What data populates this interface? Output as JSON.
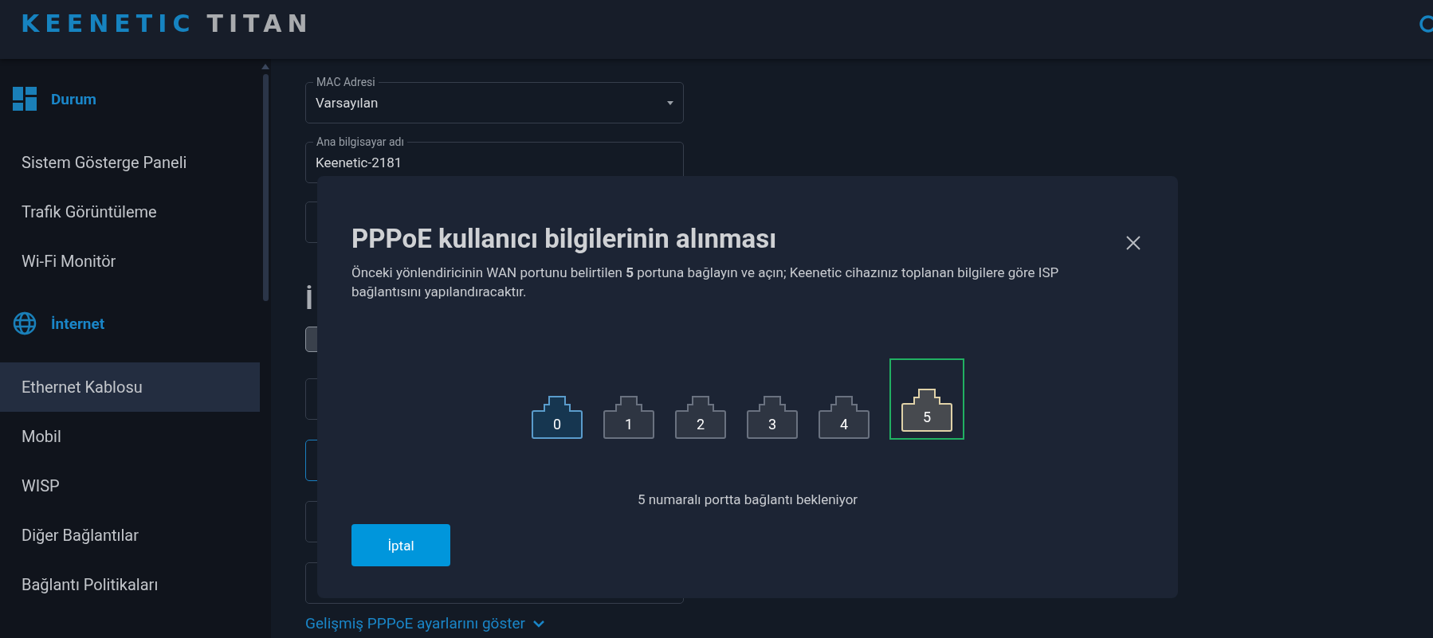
{
  "header": {
    "logo": {
      "brand": "KEENETIC",
      "model": "TITAN"
    }
  },
  "sidebar": {
    "sections": [
      {
        "title": "Durum",
        "items": [
          {
            "label": "Sistem Gösterge Paneli",
            "selected": false
          },
          {
            "label": "Trafik Görüntüleme",
            "selected": false
          },
          {
            "label": "Wi-Fi Monitör",
            "selected": false
          }
        ]
      },
      {
        "title": "İnternet",
        "items": [
          {
            "label": "Ethernet Kablosu",
            "selected": true
          },
          {
            "label": "Mobil",
            "selected": false
          },
          {
            "label": "WISP",
            "selected": false
          },
          {
            "label": "Diğer Bağlantılar",
            "selected": false
          },
          {
            "label": "Bağlantı Politikaları",
            "selected": false
          }
        ]
      }
    ]
  },
  "form": {
    "fields": [
      {
        "kind": "dropdown",
        "label": "MAC Adresi",
        "value": "Varsayılan",
        "focused": false
      },
      {
        "kind": "text",
        "label": "Ana bilgisayar adı",
        "value": "Keenetic-2181",
        "focused": false
      },
      {
        "kind": "text",
        "focused": false
      }
    ],
    "heading": "İ",
    "more_fields": [
      {
        "kind": "text",
        "focused": false
      },
      {
        "kind": "text",
        "focused": true
      },
      {
        "kind": "text",
        "focused": false
      },
      {
        "kind": "text",
        "focused": false
      }
    ],
    "advanced_link": "Gelişmiş PPPoE ayarlarını göster"
  },
  "dialog": {
    "title": "PPPoE kullanıcı bilgilerinin alınması",
    "description": "Önceki yönlendiricinin WAN portunu belirtilen **5** portuna bağlayın ve açın; Keenetic cihazınız toplanan bilgilere göre ISP bağlantısını yapılandıracaktır.",
    "ports": [
      {
        "label": "0",
        "kind": "connected",
        "selected": false
      },
      {
        "label": "1",
        "kind": "idle",
        "selected": false
      },
      {
        "label": "2",
        "kind": "idle",
        "selected": false
      },
      {
        "label": "3",
        "kind": "idle",
        "selected": false
      },
      {
        "label": "4",
        "kind": "idle",
        "selected": false
      },
      {
        "label": "5",
        "kind": "waiting",
        "selected": true
      }
    ],
    "status": "5 numaralı portta bağlantı bekleniyor",
    "buttons": [
      {
        "label": "İptal",
        "kind": "primary"
      }
    ]
  }
}
